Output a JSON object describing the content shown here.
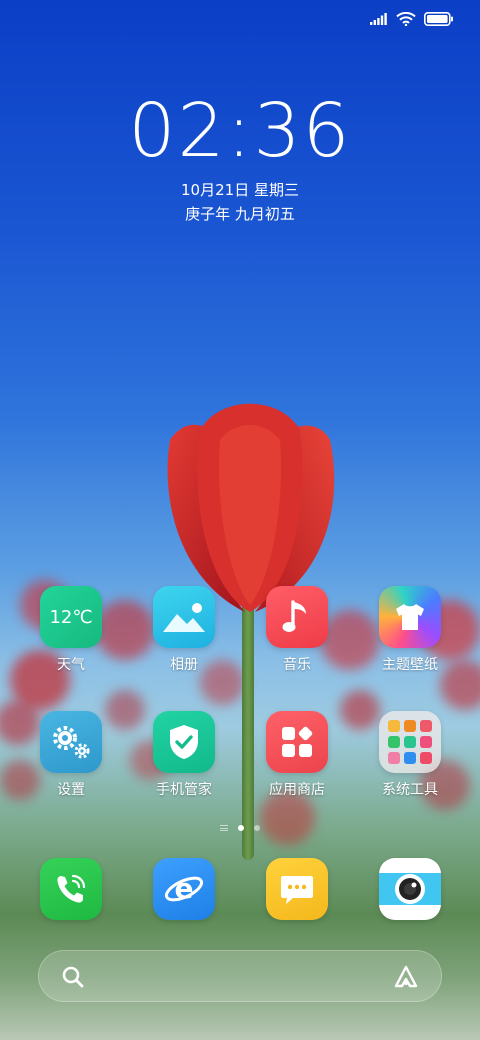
{
  "status": {
    "signal_icon": "signal-bars-icon",
    "wifi_icon": "wifi-icon",
    "battery_icon": "battery-full-icon",
    "battery_level": 1.0
  },
  "lockclock": {
    "time": "02:36",
    "date": "10月21日 星期三",
    "lunar": "庚子年 九月初五"
  },
  "apps_row1": [
    {
      "label": "天气",
      "icon": "weather-icon",
      "icon_text": "12℃",
      "color": "#1fc98e"
    },
    {
      "label": "相册",
      "icon": "gallery-icon",
      "color": "#2ac6e6"
    },
    {
      "label": "音乐",
      "icon": "music-note-icon",
      "color": "#f24d58"
    },
    {
      "label": "主题壁纸",
      "icon": "theme-shirt-icon",
      "color": "#8a5cf0"
    }
  ],
  "apps_row2": [
    {
      "label": "设置",
      "icon": "gear-icon",
      "color": "#3da9d8"
    },
    {
      "label": "手机管家",
      "icon": "shield-check-icon",
      "color": "#18c79a"
    },
    {
      "label": "应用商店",
      "icon": "app-store-icon",
      "color": "#f2545b"
    },
    {
      "label": "系统工具",
      "icon": "folder-icon",
      "color": "#e9e3e3"
    }
  ],
  "dock": [
    {
      "icon": "phone-icon",
      "color": "#2bc84a"
    },
    {
      "icon": "browser-icon",
      "color": "#2b8ff2"
    },
    {
      "icon": "messages-icon",
      "color": "#f7c62b"
    },
    {
      "icon": "camera-icon",
      "color": "#3fc4f0"
    }
  ],
  "pager": {
    "pages": 2,
    "current": 1
  },
  "search": {
    "search_icon": "search-icon",
    "assistant_icon": "assistant-icon"
  }
}
